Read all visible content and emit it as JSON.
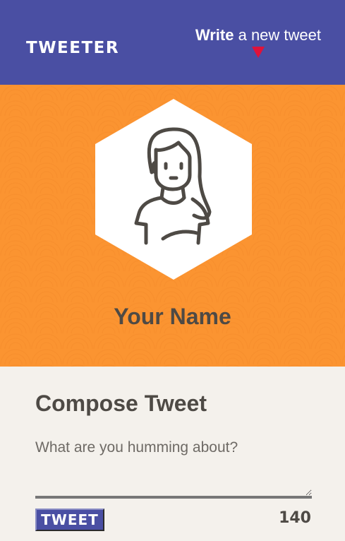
{
  "nav": {
    "logo": "TWEETER",
    "compose_bold": "Write",
    "compose_rest": " a new tweet",
    "accent": "#e0123a",
    "bar_color": "#4a4fa3"
  },
  "profile": {
    "name": "Your Name",
    "avatar_icon": "user-avatar-icon",
    "background": "#fb9431"
  },
  "compose": {
    "title": "Compose Tweet",
    "placeholder": "What are you humming about?",
    "value": "",
    "button_label": "TWEET",
    "counter": "140"
  }
}
